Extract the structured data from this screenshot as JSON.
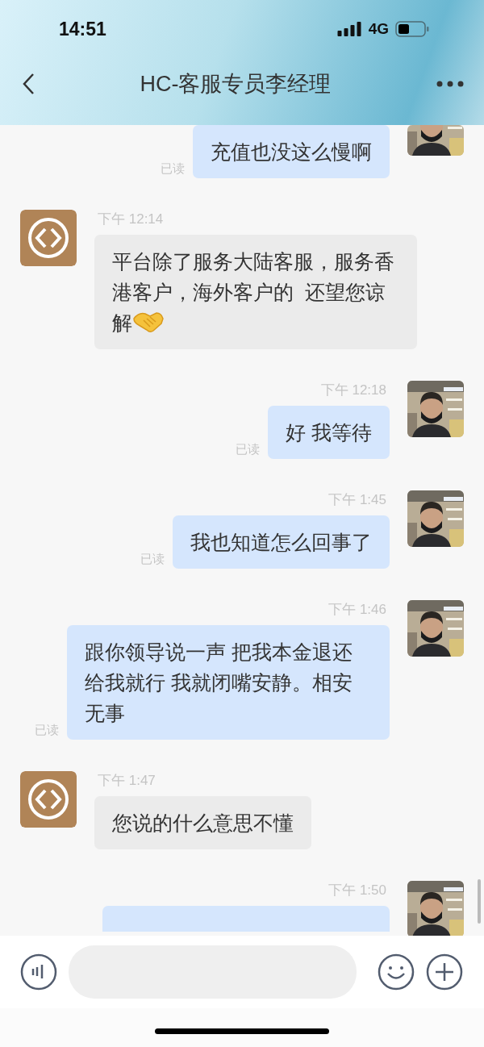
{
  "status_bar": {
    "time": "14:51",
    "network": "4G"
  },
  "header": {
    "title": "HC-客服专员李经理"
  },
  "messages": [
    {
      "kind": "outgoing",
      "text": "充值也没这么慢啊",
      "read_label": "已读"
    },
    {
      "kind": "incoming",
      "time": "下午 12:14",
      "text": "平台除了服务大陆客服，服务香港客户，海外客户的  还望您谅解",
      "trailing_emoji": true
    },
    {
      "kind": "outgoing",
      "time": "下午 12:18",
      "text": "好 我等待",
      "read_label": "已读"
    },
    {
      "kind": "outgoing",
      "time": "下午 1:45",
      "text": "我也知道怎么回事了",
      "read_label": "已读"
    },
    {
      "kind": "outgoing",
      "time": "下午 1:46",
      "text": "跟你领导说一声 把我本金退还给我就行 我就闭嘴安静。相安无事",
      "read_label": "已读"
    },
    {
      "kind": "incoming",
      "time": "下午 1:47",
      "text": "您说的什么意思不懂"
    },
    {
      "kind": "outgoing",
      "time": "下午 1:50"
    }
  ]
}
